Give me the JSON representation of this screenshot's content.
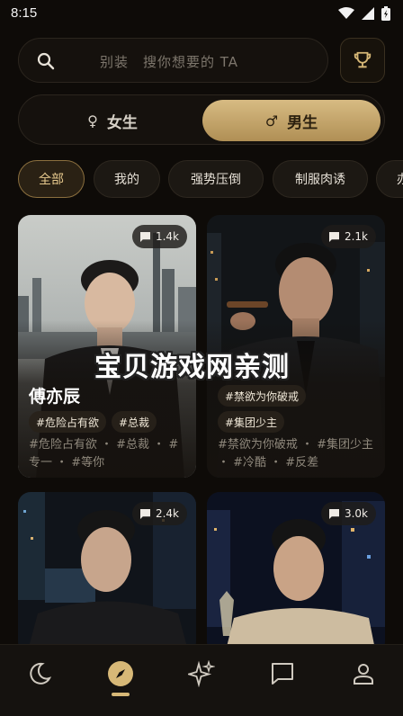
{
  "status_bar": {
    "time": "8:15"
  },
  "search": {
    "placeholder": "别装　搜你想要的 TA"
  },
  "gender_toggle": {
    "female_label": "女生",
    "male_label": "男生",
    "selected": "男生"
  },
  "categories": [
    "全部",
    "我的",
    "强势压倒",
    "制服肉诱",
    "办"
  ],
  "selected_category": "全部",
  "cards": [
    {
      "name": "傅亦辰",
      "count": "1.4k",
      "tags": [
        "#危险占有欲",
        "#总裁"
      ],
      "description": "#危险占有欲 ・ #总裁 ・ #专一 ・ #等你"
    },
    {
      "name": "",
      "count": "2.1k",
      "tags": [
        "#禁欲为你破戒",
        "#集团少主"
      ],
      "description": "#禁欲为你破戒 ・ #集团少主 ・ #冷酷 ・ #反差"
    },
    {
      "name": "",
      "count": "2.4k",
      "tags": [],
      "description": ""
    },
    {
      "name": "",
      "count": "3.0k",
      "tags": [],
      "description": ""
    }
  ],
  "watermark": "宝贝游戏网亲测",
  "bottom_nav": {
    "items": [
      "moon-icon",
      "compass-icon",
      "sparkle-icon",
      "chat-icon",
      "profile-icon"
    ],
    "active": "compass-icon"
  },
  "colors": {
    "accent_gold": "#d7b877",
    "background": "#0e0b08"
  }
}
